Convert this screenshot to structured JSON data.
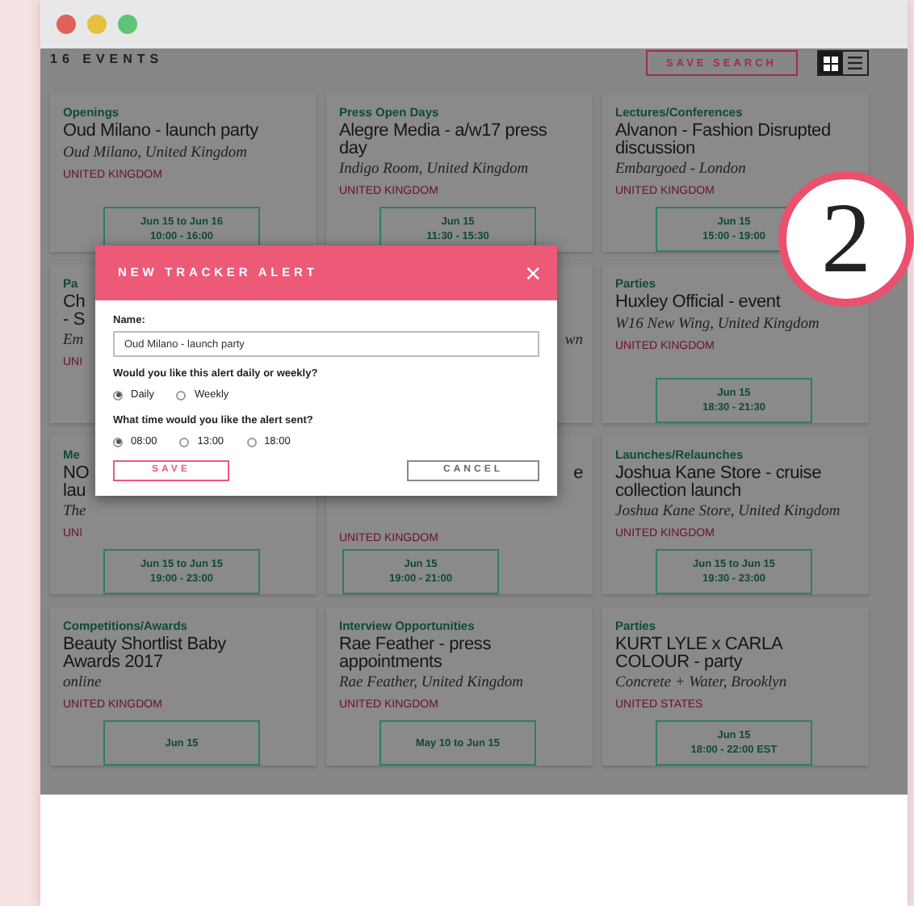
{
  "window": {
    "controls": [
      {
        "color": "#e0605a"
      },
      {
        "color": "#e8c040"
      },
      {
        "color": "#5ec47a"
      }
    ]
  },
  "header": {
    "count": "16 EVENTS",
    "save_search": "SAVE SEARCH",
    "views": [
      {
        "kind": "grid",
        "selected": true
      },
      {
        "kind": "list",
        "selected": false
      }
    ]
  },
  "cards": [
    {
      "kind": "full",
      "category": "Openings",
      "title": [
        "Oud Milano - launch party"
      ],
      "venue": "Oud Milano, United Kingdom",
      "country": "UNITED KINGDOM",
      "date": [
        "Jun 15 to Jun 16",
        "10:00 - 16:00"
      ]
    },
    {
      "kind": "full",
      "category": "Press Open Days",
      "title": [
        "Alegre Media - a/w17 press",
        "day"
      ],
      "venue": "Indigo Room, United Kingdom",
      "country": "UNITED KINGDOM",
      "date": [
        "Jun 15",
        "11:30 - 15:30"
      ]
    },
    {
      "kind": "full",
      "category": "Lectures/Conferences",
      "title": [
        "Alvanon - Fashion Disrupted",
        "discussion"
      ],
      "venue": "Embargoed - London",
      "country": "UNITED KINGDOM",
      "date": [
        "Jun 15",
        "15:00 - 19:00"
      ]
    },
    {
      "kind": "start",
      "category": "Pa",
      "title": [
        "Ch",
        "- S"
      ],
      "venue": "Em",
      "country": "UNI"
    },
    {
      "kind": "end",
      "venue": "wn"
    },
    {
      "kind": "full",
      "category": "Parties",
      "title": [
        "Huxley Official - event"
      ],
      "venue": "W16 New Wing, United Kingdom",
      "country": "UNITED KINGDOM",
      "date": [
        "Jun 15",
        "18:30 - 21:30"
      ]
    },
    {
      "kind": "start",
      "category": "Me",
      "title": [
        "NO",
        "lau"
      ],
      "venue": "The",
      "country": "UNI",
      "date": [
        "Jun 15 to Jun 15",
        "19:00 - 23:00"
      ]
    },
    {
      "kind": "end",
      "title": [
        "e"
      ],
      "country": "UNITED KINGDOM",
      "date": [
        "Jun 15",
        "19:00 - 21:00"
      ]
    },
    {
      "kind": "full",
      "category": "Launches/Relaunches",
      "title": [
        "Joshua Kane Store - cruise",
        "collection launch"
      ],
      "venue": "Joshua Kane Store, United Kingdom",
      "country": "UNITED KINGDOM",
      "date": [
        "Jun 15 to Jun 15",
        "19:30 - 23:00"
      ]
    },
    {
      "kind": "full",
      "category": "Competitions/Awards",
      "title": [
        "Beauty Shortlist Baby",
        "Awards 2017"
      ],
      "venue": "online",
      "country": "UNITED KINGDOM",
      "date": [
        "Jun 15"
      ]
    },
    {
      "kind": "full",
      "category": "Interview Opportunities",
      "title": [
        "Rae Feather - press",
        "appointments"
      ],
      "venue": "Rae Feather, United Kingdom",
      "country": "UNITED KINGDOM",
      "date": [
        "May 10 to Jun 15"
      ]
    },
    {
      "kind": "full",
      "category": "Parties",
      "title": [
        "KURT LYLE x CARLA",
        "COLOUR - party"
      ],
      "venue": "Concrete + Water, Brooklyn",
      "country": "UNITED STATES",
      "date": [
        "Jun 15",
        "18:00 - 22:00 EST"
      ]
    }
  ],
  "modal": {
    "title": "NEW TRACKER ALERT",
    "close": "×",
    "name_label": "Name:",
    "name_value": "Oud Milano - launch party",
    "frequency_label": "Would you like this alert daily or weekly?",
    "frequency_options": [
      {
        "label": "Daily",
        "selected": true
      },
      {
        "label": "Weekly",
        "selected": false
      }
    ],
    "time_label": "What time would you like the alert sent?",
    "time_options": [
      {
        "label": "08:00",
        "selected": true
      },
      {
        "label": "13:00",
        "selected": false
      },
      {
        "label": "18:00",
        "selected": false
      }
    ],
    "save": "SAVE",
    "cancel": "CANCEL"
  },
  "step_badge": "2"
}
